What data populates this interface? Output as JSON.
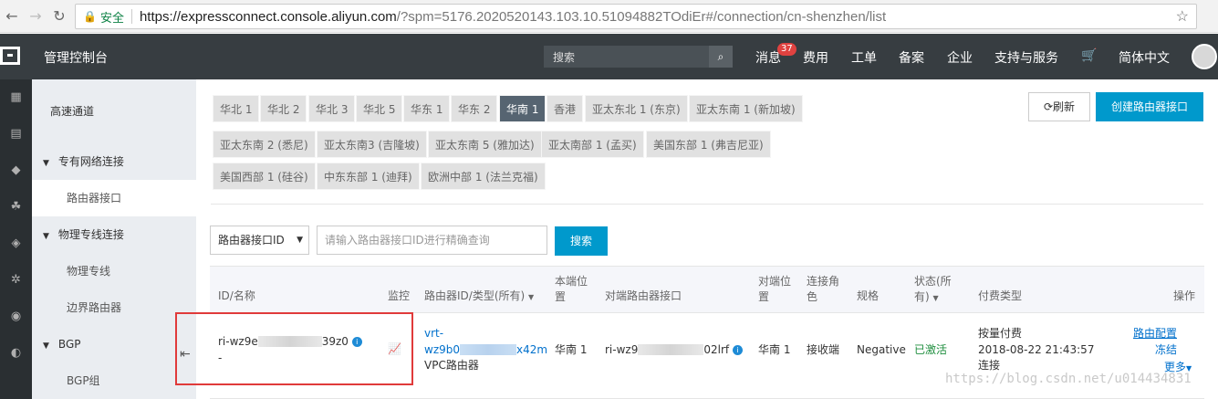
{
  "browser": {
    "secure_label": "安全",
    "url_main": "https://expressconnect.console.aliyun.com",
    "url_rest": "/?spm=5176.2020520143.103.10.51094882TOdiEr#/connection/cn-shenzhen/list"
  },
  "topbar": {
    "console_title": "管理控制台",
    "search_placeholder": "搜索",
    "menu": [
      "消息",
      "费用",
      "工单",
      "备案",
      "企业",
      "支持与服务",
      "简体中文"
    ],
    "message_badge": "37"
  },
  "sidebar": {
    "title": "高速通道",
    "groups": [
      {
        "label": "专有网络连接",
        "items": [
          "路由器接口"
        ]
      },
      {
        "label": "物理专线连接",
        "items": [
          "物理专线",
          "边界路由器"
        ]
      },
      {
        "label": "BGP",
        "items": [
          "BGP组"
        ]
      }
    ]
  },
  "regions": [
    "华北 1",
    "华北 2",
    "华北 3",
    "华北 5",
    "华东 1",
    "华东 2",
    "华南 1",
    "香港",
    "亚太东北 1 (东京)",
    "亚太东南 1 (新加坡)",
    "亚太东南 2 (悉尼)",
    "亚太东南3 (吉隆坡)",
    "亚太东南 5 (雅加达)",
    "亚太南部 1 (孟买)",
    "美国东部 1 (弗吉尼亚)",
    "美国西部 1 (硅谷)",
    "中东东部 1 (迪拜)",
    "欧洲中部 1 (法兰克福)"
  ],
  "active_region": "华南 1",
  "actions": {
    "refresh": "刷新",
    "create": "创建路由器接口"
  },
  "filter": {
    "select_value": "路由器接口ID",
    "input_placeholder": "请输入路由器接口ID进行精确查询",
    "search": "搜索"
  },
  "table": {
    "headers": {
      "id": "ID/名称",
      "monitor": "监控",
      "router": "路由器ID/类型(所有)",
      "local_1": "本端位",
      "local_2": "置",
      "peer_if": "对端路由器接口",
      "peer_loc_1": "对端位",
      "peer_loc_2": "置",
      "role_1": "连接角",
      "role_2": "色",
      "spec": "规格",
      "status_1": "状态(所",
      "status_2": "有)",
      "billing": "付费类型",
      "ops": "操作"
    },
    "row": {
      "id_prefix": "ri-wz9e",
      "id_suffix": "39z0",
      "name": "-",
      "router_prefix": "vrt-",
      "router_id_start": "wz9b0",
      "router_id_end": "x42m",
      "router_type": "VPC路由器",
      "local": "华南 1",
      "peer_prefix": "ri-wz9",
      "peer_suffix": "02lrf",
      "peer_loc": "华南 1",
      "role": "接收端",
      "spec": "Negative",
      "status": "已激活",
      "billing_type": "按量付费",
      "billing_time": "2018-08-22 21:43:57",
      "billing_state": "连接",
      "op_config": "路由配置",
      "op_freeze": "冻结",
      "op_more": "更多"
    }
  },
  "watermark": "https://blog.csdn.net/u014434831",
  "colors": {
    "accent": "#0099cc",
    "topbar": "#373d41",
    "active_region": "#566471",
    "highlight_box": "#e03a3a"
  }
}
